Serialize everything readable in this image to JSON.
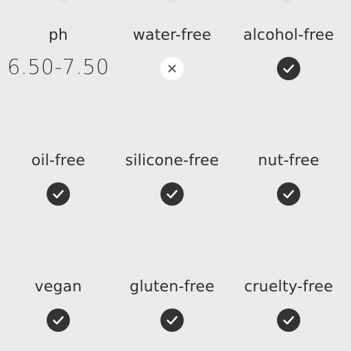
{
  "colors": {
    "background": "#ebebeb",
    "text": "#2f2f2f",
    "check_fill": "#333333",
    "cross_fill": "#ffffff",
    "cross_stroke": "#555555"
  },
  "attributes": [
    {
      "label": "ph",
      "value": "6.50-7.50",
      "icon": null
    },
    {
      "label": "water-free",
      "value": null,
      "icon": "cross-icon"
    },
    {
      "label": "alcohol-free",
      "value": null,
      "icon": "check-icon"
    },
    {
      "label": "oil-free",
      "value": null,
      "icon": "check-icon"
    },
    {
      "label": "silicone-free",
      "value": null,
      "icon": "check-icon"
    },
    {
      "label": "nut-free",
      "value": null,
      "icon": "check-icon"
    },
    {
      "label": "vegan",
      "value": null,
      "icon": "check-icon"
    },
    {
      "label": "gluten-free",
      "value": null,
      "icon": "check-icon"
    },
    {
      "label": "cruelty-free",
      "value": null,
      "icon": "check-icon"
    }
  ]
}
